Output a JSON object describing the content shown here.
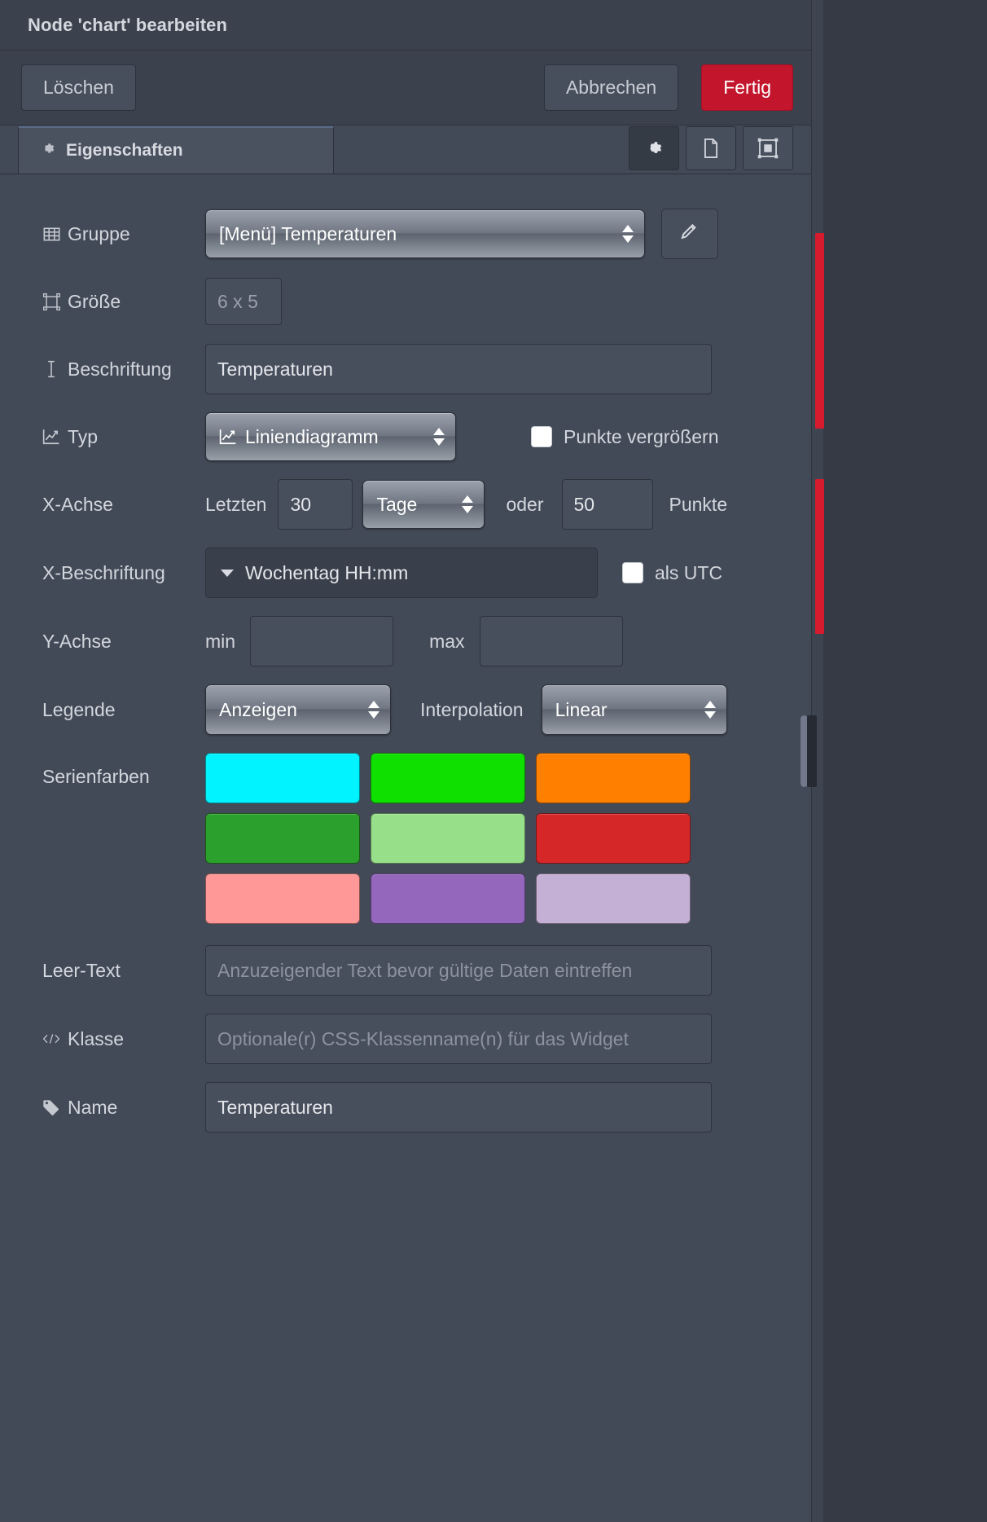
{
  "dialog": {
    "title": "Node 'chart' bearbeiten",
    "toolbar": {
      "delete_label": "Löschen",
      "cancel_label": "Abbrechen",
      "done_label": "Fertig"
    },
    "tabs": [
      {
        "label": "Eigenschaften",
        "icon": "gear-icon"
      }
    ],
    "tab_icon_buttons": [
      {
        "name": "properties-gear-icon",
        "active": true
      },
      {
        "name": "description-document-icon",
        "active": false
      },
      {
        "name": "appearance-frame-icon",
        "active": false
      }
    ]
  },
  "form": {
    "group": {
      "label": "Gruppe",
      "value": "[Menü] Temperaturen",
      "edit_button_icon": "pencil-icon"
    },
    "size": {
      "label": "Größe",
      "value": "6 x 5"
    },
    "caption": {
      "label": "Beschriftung",
      "value": "Temperaturen"
    },
    "type": {
      "label": "Typ",
      "value": "Liniendiagramm",
      "enlarge_points_label": "Punkte vergrößern",
      "enlarge_points_checked": false
    },
    "xaxis": {
      "label": "X-Achse",
      "last_label": "Letzten",
      "last_value": "30",
      "unit_value": "Tage",
      "or_label": "oder",
      "points_value": "50",
      "points_label": "Punkte"
    },
    "xlabel": {
      "label": "X-Beschriftung",
      "value": "Wochentag HH:mm",
      "utc_label": "als UTC",
      "utc_checked": false
    },
    "yaxis": {
      "label": "Y-Achse",
      "min_label": "min",
      "min_value": "",
      "max_label": "max",
      "max_value": ""
    },
    "legend": {
      "label": "Legende",
      "value": "Anzeigen"
    },
    "interpolation": {
      "label": "Interpolation",
      "value": "Linear"
    },
    "series_colors": {
      "label": "Serienfarben",
      "rows": [
        [
          "#00f3ff",
          "#0fe000",
          "#ff8000"
        ],
        [
          "#2ca02c",
          "#98df8a",
          "#d62728"
        ],
        [
          "#ff9896",
          "#9467bd",
          "#c5b0d5"
        ]
      ]
    },
    "empty_text": {
      "label": "Leer-Text",
      "value": "",
      "placeholder": "Anzuzeigender Text bevor gültige Daten eintreffen"
    },
    "css_class": {
      "label": "Klasse",
      "value": "",
      "placeholder": "Optionale(r) CSS-Klassenname(n) für das Widget"
    },
    "name": {
      "label": "Name",
      "value": "Temperaturen"
    }
  },
  "theme": {
    "accent_red": "#c3152c",
    "panel_bg": "#434a57",
    "header_bg": "#3b414d",
    "input_bg": "#474e5c",
    "text": "#d2d6dd"
  }
}
